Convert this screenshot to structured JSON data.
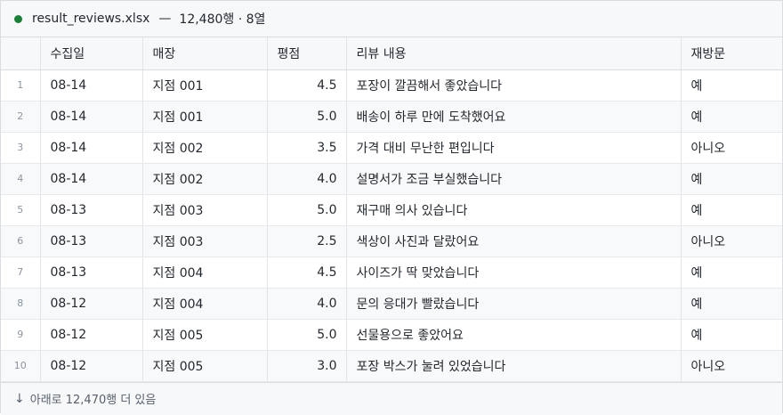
{
  "colors": {
    "status_dot": "#1a7f37",
    "header_bg": "#f6f8fa",
    "stripe_bg": "#f7f9fa",
    "border": "#d8dde3"
  },
  "file": {
    "name": "result_reviews.xlsx",
    "separator": "—",
    "meta": "12,480행 · 8열"
  },
  "table": {
    "columns": [
      "수집일",
      "매장",
      "평점",
      "리뷰 내용",
      "재방문"
    ],
    "rows": [
      {
        "index": "1",
        "date": "08-14",
        "store": "지점 001",
        "score": "4.5",
        "review": "포장이 깔끔해서 좋았습니다",
        "revisit": "예"
      },
      {
        "index": "2",
        "date": "08-14",
        "store": "지점 001",
        "score": "5.0",
        "review": "배송이 하루 만에 도착했어요",
        "revisit": "예"
      },
      {
        "index": "3",
        "date": "08-14",
        "store": "지점 002",
        "score": "3.5",
        "review": "가격 대비 무난한 편입니다",
        "revisit": "아니오"
      },
      {
        "index": "4",
        "date": "08-14",
        "store": "지점 002",
        "score": "4.0",
        "review": "설명서가 조금 부실했습니다",
        "revisit": "예"
      },
      {
        "index": "5",
        "date": "08-13",
        "store": "지점 003",
        "score": "5.0",
        "review": "재구매 의사 있습니다",
        "revisit": "예"
      },
      {
        "index": "6",
        "date": "08-13",
        "store": "지점 003",
        "score": "2.5",
        "review": "색상이 사진과 달랐어요",
        "revisit": "아니오"
      },
      {
        "index": "7",
        "date": "08-13",
        "store": "지점 004",
        "score": "4.5",
        "review": "사이즈가 딱 맞았습니다",
        "revisit": "예"
      },
      {
        "index": "8",
        "date": "08-12",
        "store": "지점 004",
        "score": "4.0",
        "review": "문의 응대가 빨랐습니다",
        "revisit": "예"
      },
      {
        "index": "9",
        "date": "08-12",
        "store": "지점 005",
        "score": "5.0",
        "review": "선물용으로 좋았어요",
        "revisit": "예"
      },
      {
        "index": "10",
        "date": "08-12",
        "store": "지점 005",
        "score": "3.0",
        "review": "포장 박스가 눌려 있었습니다",
        "revisit": "아니오"
      }
    ]
  },
  "footer": {
    "arrow": "↓",
    "text": "아래로 12,470행 더 있음"
  }
}
